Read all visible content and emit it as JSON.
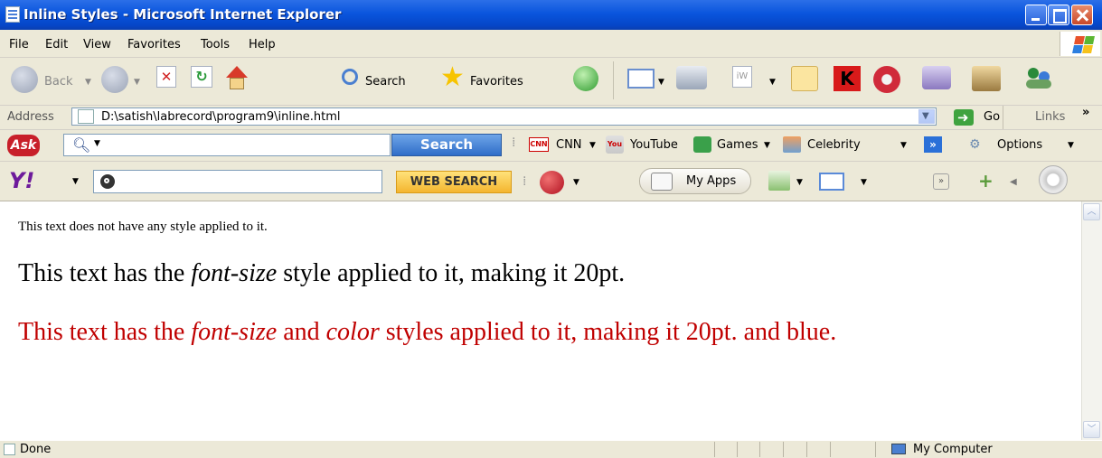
{
  "window": {
    "title": "Inline Styles - Microsoft Internet Explorer"
  },
  "menu": [
    "File",
    "Edit",
    "View",
    "Favorites",
    "Tools",
    "Help"
  ],
  "toolbar": {
    "back": "Back",
    "search": "Search",
    "favorites": "Favorites"
  },
  "address": {
    "label": "Address",
    "url": "D:\\satish\\labrecord\\program9\\inline.html",
    "go": "Go",
    "links": "Links",
    "chevron": "»"
  },
  "ask": {
    "logo": "Ask",
    "search_button": "Search",
    "items": [
      "CNN",
      "YouTube",
      "Games",
      "Celebrity"
    ],
    "options": "Options",
    "more": "»"
  },
  "yahoo": {
    "logo": "Y!",
    "search_button": "WEB SEARCH",
    "myapps": "My Apps",
    "more": "»"
  },
  "content": {
    "line1": "This text does not have any style applied to it.",
    "line2": {
      "a": "This text has the ",
      "b": "font-size",
      "c": " style applied to it, making it 20pt."
    },
    "line3": {
      "a": "This text has the ",
      "b": "font-size",
      "c": " and ",
      "d": "color",
      "e": " styles applied to it, making it 20pt. and blue."
    },
    "line3_color": "#c00000"
  },
  "status": {
    "text": "Done",
    "zone": "My Computer"
  }
}
